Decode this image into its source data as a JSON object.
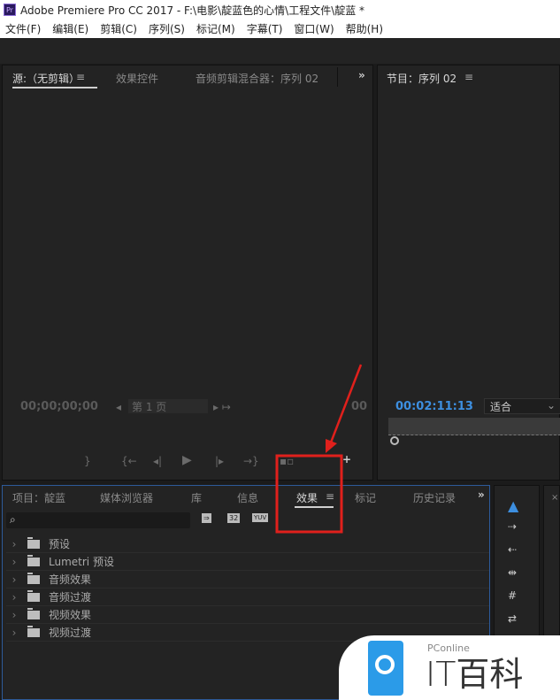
{
  "window": {
    "title": "Adobe Premiere Pro CC 2017 - F:\\电影\\靛蓝色的心情\\工程文件\\靛蓝 *",
    "logo": "Pr"
  },
  "menu": [
    "文件(F)",
    "编辑(E)",
    "剪辑(C)",
    "序列(S)",
    "标记(M)",
    "字幕(T)",
    "窗口(W)",
    "帮助(H)"
  ],
  "source_panel": {
    "tabs": [
      "源:（无剪辑）",
      "效果控件",
      "音频剪辑混合器：序列 02"
    ],
    "menu_icon": "≡",
    "overflow": "»",
    "timecode": "00;00;00;00",
    "page_select": "第 1 页",
    "timecode_right": "00"
  },
  "program_panel": {
    "tab": "节目：序列 02",
    "menu_icon": "≡",
    "timecode": "00:02:11:13",
    "fit": "适合",
    "timecode_color": "#3d8fe0"
  },
  "project_panel": {
    "tabs": [
      "项目：靛蓝",
      "媒体浏览器",
      "库",
      "信息",
      "效果",
      "标记",
      "历史记录"
    ],
    "active_tab": "效果",
    "menu_icon": "≡",
    "overflow": "»",
    "search_placeholder": "",
    "filter_buttons": [
      "⇒",
      "32",
      "YUV"
    ],
    "items": [
      {
        "label": "预设",
        "starred": true
      },
      {
        "label": "Lumetri 预设",
        "starred": true
      },
      {
        "label": "音频效果"
      },
      {
        "label": "音频过渡"
      },
      {
        "label": "视频效果"
      },
      {
        "label": "视频过渡"
      }
    ]
  },
  "watermark": {
    "brand": "PConline",
    "name": "IT百科"
  },
  "annotation_color": "#e0201c"
}
